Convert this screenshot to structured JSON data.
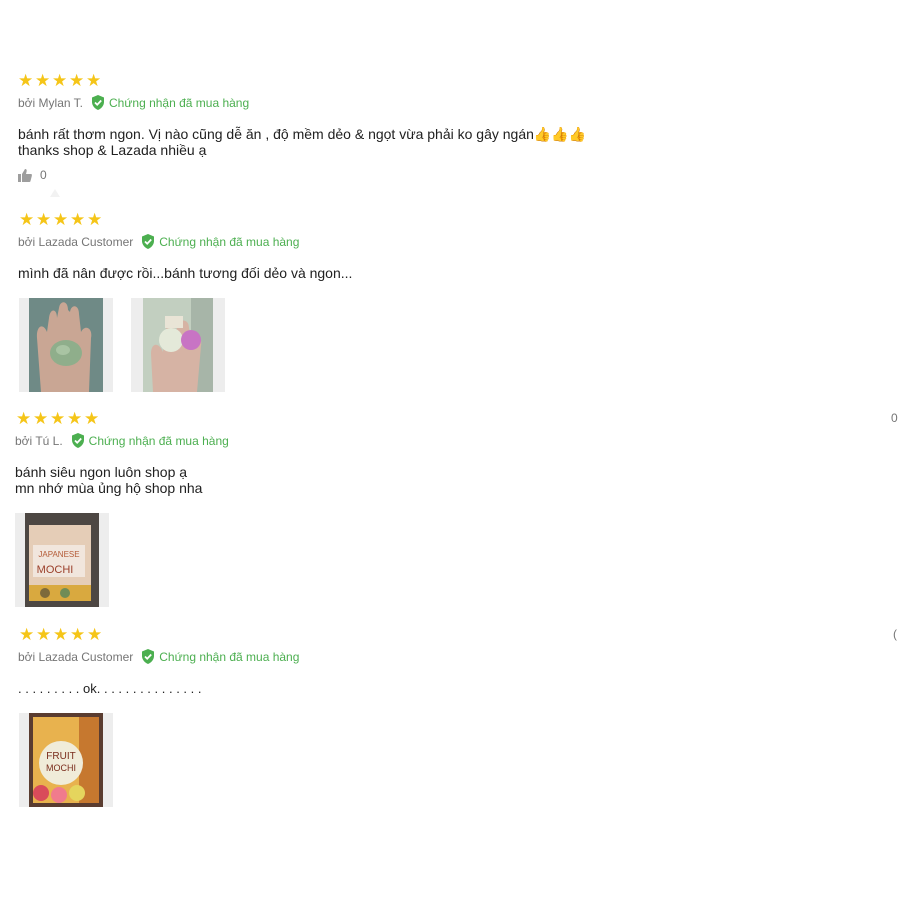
{
  "verified_label": "Chứng nhận đã mua hàng",
  "reviews": [
    {
      "rating": 5,
      "author": "bởi Mylan T.",
      "lines": [
        "bánh rất thơm ngon. Vị nào cũng dễ ăn , độ mềm dẻo & ngọt vừa phải ko gây ngán👍👍👍",
        "thanks shop & Lazada nhiều ạ"
      ],
      "likes": "0",
      "images": []
    },
    {
      "rating": 5,
      "author": "bởi Lazada Customer",
      "lines": [
        "mình đã nân được rồi...bánh tương đối dẻo và ngon..."
      ],
      "images": [
        "hand-holding-green-mochi",
        "hand-holding-packaged-mochi"
      ]
    },
    {
      "rating": 5,
      "author": "bởi Tú L.",
      "lines": [
        "bánh siêu ngon luôn shop ạ",
        "mn nhớ mùa ủng hộ shop nha"
      ],
      "side_count": "0",
      "images": [
        "japanese-mochi-package"
      ],
      "package_text": [
        "JAPANESE",
        "MOCHI"
      ]
    },
    {
      "rating": 5,
      "author": "bởi Lazada Customer",
      "lines": [
        ". . . . . . . . . ok. . . . . . . . . . . . . . ."
      ],
      "side_count": "(",
      "images": [
        "fruit-mochi-package"
      ],
      "package_text": [
        "FRUIT",
        "MOCHI"
      ]
    }
  ],
  "colors": {
    "star": "#f5c518",
    "verified": "#4caf50",
    "muted": "#757575"
  }
}
